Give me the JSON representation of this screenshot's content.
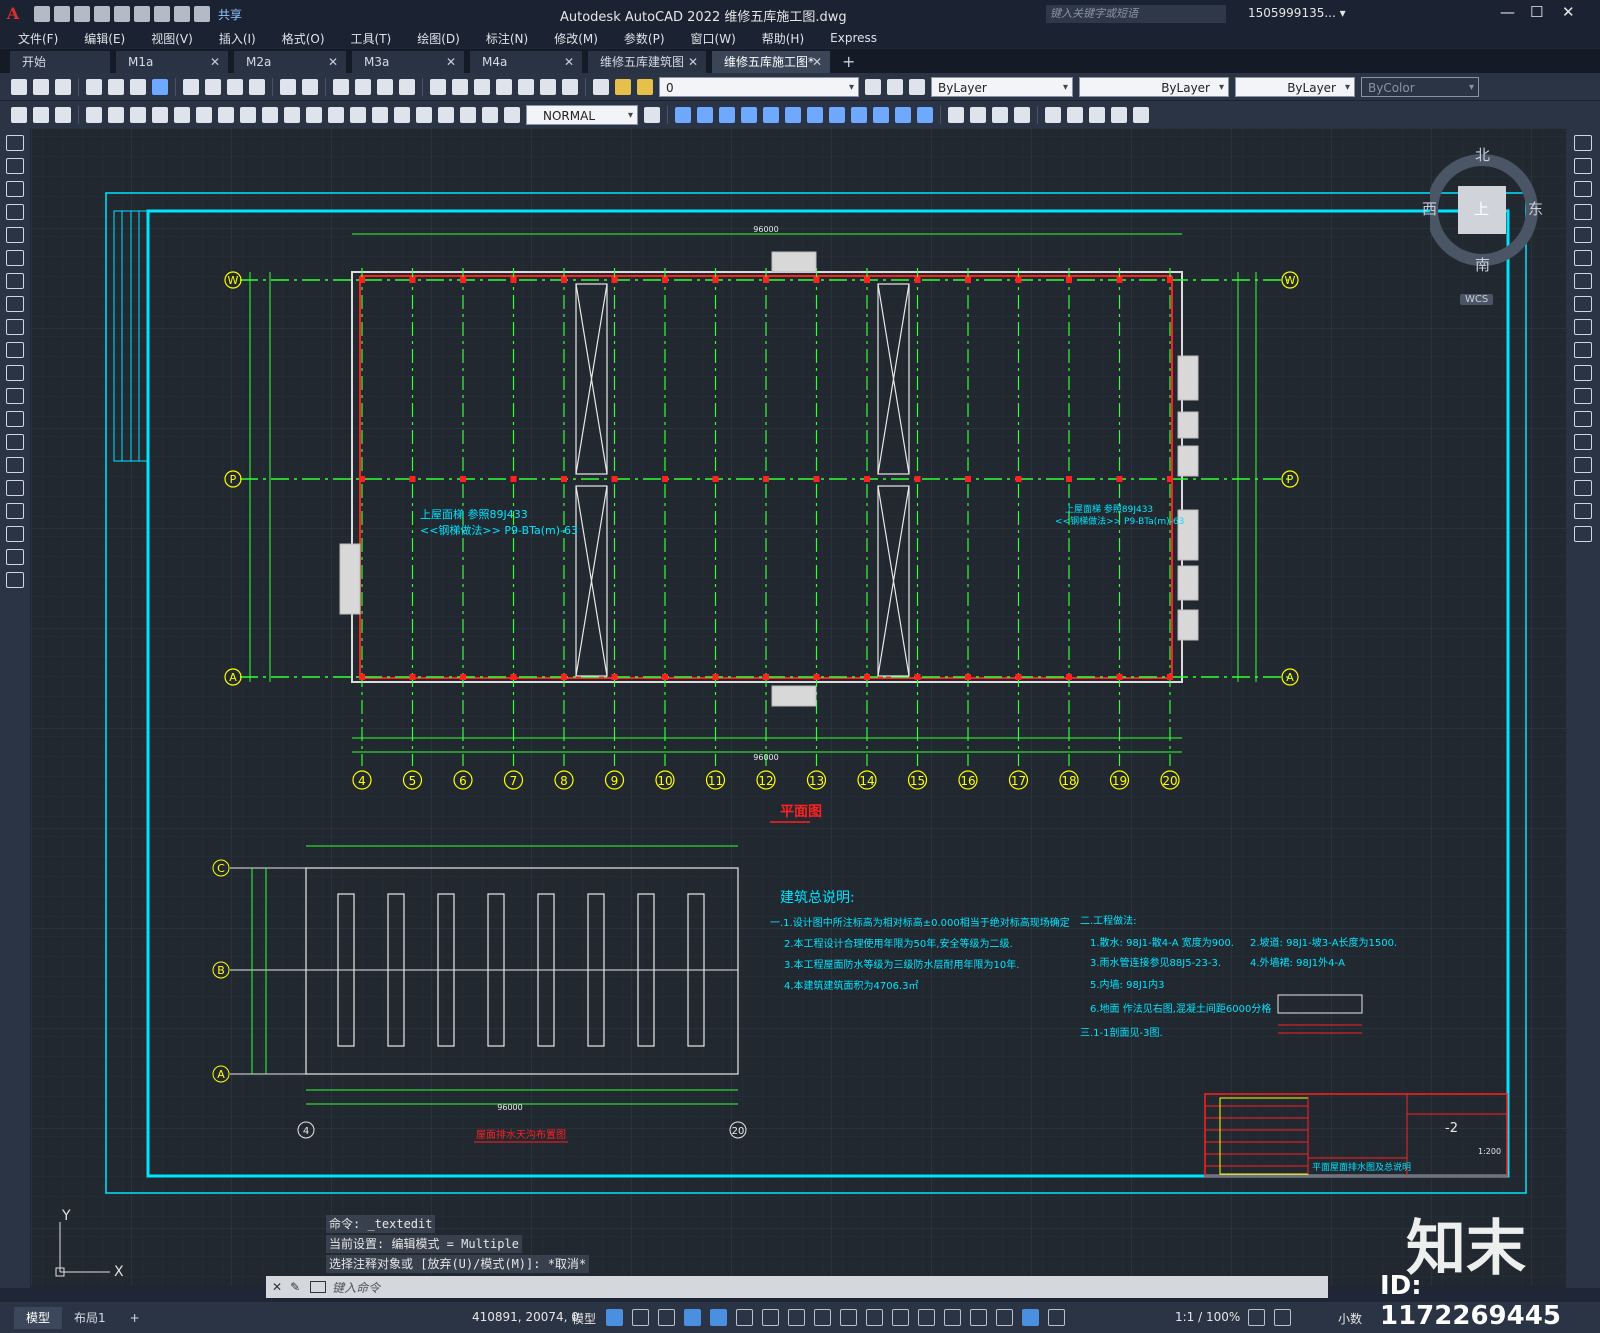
{
  "titlebar": {
    "logo": "A",
    "share": "共享",
    "app_title": "Autodesk AutoCAD 2022    维修五库施工图.dwg",
    "search_placeholder": "键入关键字或短语",
    "user": "1505999135... ▾",
    "minimize": "—",
    "maximize": "☐",
    "close": "✕"
  },
  "menu": [
    "文件(F)",
    "编辑(E)",
    "视图(V)",
    "插入(I)",
    "格式(O)",
    "工具(T)",
    "绘图(D)",
    "标注(N)",
    "修改(M)",
    "参数(P)",
    "窗口(W)",
    "帮助(H)",
    "Express"
  ],
  "tabs": [
    {
      "label": "开始",
      "active": false
    },
    {
      "label": "M1a",
      "active": false
    },
    {
      "label": "M2a",
      "active": false
    },
    {
      "label": "M3a",
      "active": false
    },
    {
      "label": "M4a",
      "active": false
    },
    {
      "label": "维修五库建筑图",
      "active": false
    },
    {
      "label": "维修五库施工图*",
      "active": true
    }
  ],
  "toolbar": {
    "layer_value": "0",
    "color_value": "ByLayer",
    "linetype_value": "ByLayer",
    "lineweight_value": "ByLayer",
    "plotstyle_value": "ByColor",
    "dimstyle_value": "NORMAL"
  },
  "viewcube": {
    "north": "北",
    "south": "南",
    "east": "东",
    "west": "西",
    "top": "上",
    "wcs": "WCS"
  },
  "drawing": {
    "plan_title": "平面图",
    "roof_title": "屋面排水天沟布置图",
    "notes_title": "建筑总说明:",
    "notes": [
      "一.1.设计图中所注标高为相对标高±0.000相当于绝对标高现场确定",
      "2.本工程设计合理使用年限为50年,安全等级为二级.",
      "3.本工程屋面防水等级为三级防水层耐用年限为10年.",
      "4.本建筑建筑面积为4706.3㎡"
    ],
    "notes2": [
      "二.工程做法:",
      "1.散水: 98J1-散4-A 宽度为900.",
      "2.坡道: 98J1-坡3-A长度为1500.",
      "3.雨水管连接参见88J5-23-3.",
      "4.外墙裙: 98J1外4-A",
      "5.内墙: 98J1内3",
      "6.地面 作法见右图,混凝土间距6000分格",
      "三.1-1剖面见-3图."
    ],
    "axis_top": [
      "W",
      "P",
      "A"
    ],
    "axis_bottom": [
      "4",
      "5",
      "6",
      "7",
      "8",
      "9",
      "10",
      "11",
      "12",
      "13",
      "14",
      "15",
      "16",
      "17",
      "18",
      "19",
      "20"
    ],
    "roof_axes": [
      "C",
      "B",
      "A"
    ],
    "roof_bottom_axes": [
      "4",
      "20"
    ],
    "total_dim": "96000",
    "sheet_no": "-2",
    "sheet_scale": "1:200",
    "titleblock_name": "平面屋面排水图及总说明"
  },
  "command": {
    "history": [
      "命令: _textedit",
      "当前设置: 编辑模式 = Multiple",
      "选择注释对象或 [放弃(U)/模式(M)]: *取消*"
    ],
    "placeholder": "键入命令"
  },
  "statusbar": {
    "tabs": [
      {
        "label": "模型",
        "active": true
      },
      {
        "label": "布局1",
        "active": false
      }
    ],
    "add": "+",
    "coords": "410891, 20074, 0",
    "model": "模型",
    "scale": "1:1 / 100%",
    "units": "小数"
  },
  "watermark": {
    "brand": "知末",
    "id": "ID: 1172269445"
  },
  "colors": {
    "cad_bg": "#212830",
    "grid": "#2c3440",
    "cyan": "#00e5ff",
    "green": "#33ff33",
    "yellow": "#ffff00",
    "red": "#ff2020"
  }
}
